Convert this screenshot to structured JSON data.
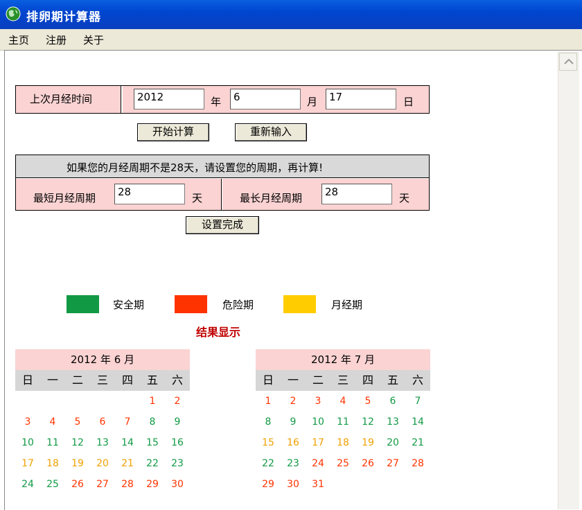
{
  "window": {
    "title": "排卵期计算器",
    "icon": "globe-icon"
  },
  "menu": [
    "主页",
    "注册",
    "关于"
  ],
  "last_period": {
    "label": "上次月经时间",
    "year_value": "2012",
    "year_unit": "年",
    "month_value": "6",
    "month_unit": "月",
    "day_value": "17",
    "day_unit": "日"
  },
  "buttons": {
    "calculate": "开始计算",
    "reset": "重新输入",
    "set_done": "设置完成"
  },
  "cycle": {
    "notice": "如果您的月经周期不是28天，请设置您的周期，再计算!",
    "min_label": "最短月经周期",
    "min_value": "28",
    "min_unit": "天",
    "max_label": "最长月经周期",
    "max_value": "28",
    "max_unit": "天"
  },
  "legend": [
    {
      "label": "安全期",
      "color": "#119944"
    },
    {
      "label": "危险期",
      "color": "#ff3300"
    },
    {
      "label": "月经期",
      "color": "#ffcc00"
    }
  ],
  "result_title": "结果显示",
  "weekdays": [
    "日",
    "一",
    "二",
    "三",
    "四",
    "五",
    "六"
  ],
  "calendars": [
    {
      "title": "2012 年 6 月",
      "rows": [
        [
          [
            "",
            ""
          ],
          [
            "",
            ""
          ],
          [
            "",
            ""
          ],
          [
            "",
            ""
          ],
          [
            "",
            ""
          ],
          [
            "1",
            "d"
          ],
          [
            "2",
            "d"
          ]
        ],
        [
          [
            "3",
            "d"
          ],
          [
            "4",
            "d"
          ],
          [
            "5",
            "d"
          ],
          [
            "6",
            "d"
          ],
          [
            "7",
            "d"
          ],
          [
            "8",
            "s"
          ],
          [
            "9",
            "s"
          ]
        ],
        [
          [
            "10",
            "s"
          ],
          [
            "11",
            "s"
          ],
          [
            "12",
            "s"
          ],
          [
            "13",
            "s"
          ],
          [
            "14",
            "s"
          ],
          [
            "15",
            "s"
          ],
          [
            "16",
            "s"
          ]
        ],
        [
          [
            "17",
            "m"
          ],
          [
            "18",
            "m"
          ],
          [
            "19",
            "m"
          ],
          [
            "20",
            "m"
          ],
          [
            "21",
            "m"
          ],
          [
            "22",
            "s"
          ],
          [
            "23",
            "s"
          ]
        ],
        [
          [
            "24",
            "s"
          ],
          [
            "25",
            "s"
          ],
          [
            "26",
            "d"
          ],
          [
            "27",
            "d"
          ],
          [
            "28",
            "d"
          ],
          [
            "29",
            "d"
          ],
          [
            "30",
            "d"
          ]
        ]
      ]
    },
    {
      "title": "2012 年 7 月",
      "rows": [
        [
          [
            "1",
            "d"
          ],
          [
            "2",
            "d"
          ],
          [
            "3",
            "d"
          ],
          [
            "4",
            "d"
          ],
          [
            "5",
            "d"
          ],
          [
            "6",
            "s"
          ],
          [
            "7",
            "s"
          ]
        ],
        [
          [
            "8",
            "s"
          ],
          [
            "9",
            "s"
          ],
          [
            "10",
            "s"
          ],
          [
            "11",
            "s"
          ],
          [
            "12",
            "s"
          ],
          [
            "13",
            "s"
          ],
          [
            "14",
            "s"
          ]
        ],
        [
          [
            "15",
            "m"
          ],
          [
            "16",
            "m"
          ],
          [
            "17",
            "m"
          ],
          [
            "18",
            "m"
          ],
          [
            "19",
            "m"
          ],
          [
            "20",
            "s"
          ],
          [
            "21",
            "s"
          ]
        ],
        [
          [
            "22",
            "s"
          ],
          [
            "23",
            "s"
          ],
          [
            "24",
            "d"
          ],
          [
            "25",
            "d"
          ],
          [
            "26",
            "d"
          ],
          [
            "27",
            "d"
          ],
          [
            "28",
            "d"
          ]
        ],
        [
          [
            "29",
            "d"
          ],
          [
            "30",
            "d"
          ],
          [
            "31",
            "d"
          ],
          [
            "",
            ""
          ],
          [
            "",
            ""
          ],
          [
            "",
            ""
          ],
          [
            "",
            ""
          ]
        ]
      ]
    }
  ]
}
